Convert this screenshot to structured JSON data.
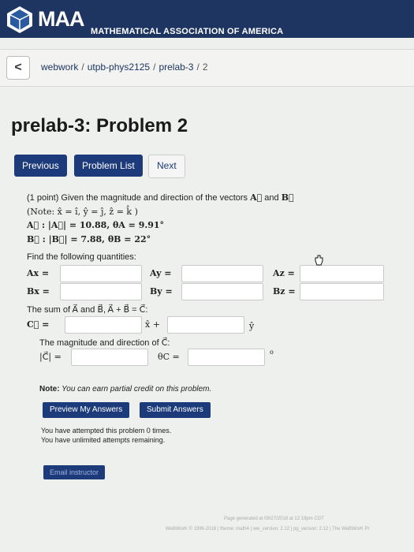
{
  "header": {
    "logo_text": "MAA",
    "org_name": "MATHEMATICAL ASSOCIATION OF AMERICA"
  },
  "breadcrumb": {
    "back": "<",
    "parts": [
      "webwork",
      "utpb-phys2125",
      "prelab-3",
      "2"
    ]
  },
  "page_title": "prelab-3: Problem 2",
  "nav": {
    "previous": "Previous",
    "problem_list": "Problem List",
    "next": "Next"
  },
  "problem": {
    "intro_a": "(1 point) Given the magnitude and direction of the vectors ",
    "vec_a": "A⃗",
    "and": " and ",
    "vec_b": "B⃗",
    "note": "(Note: x̂ = î, ŷ = ĵ, ẑ = k̂ )",
    "line_a": "A⃗ : |A⃗| = 10.88, θA = 9.91°",
    "line_b": "B⃗ : |B⃗| = 7.88, θB = 22°",
    "find": "Find the following quantities:",
    "labels": {
      "ax": "Ax =",
      "ay": "Ay =",
      "az": "Az =",
      "bx": "Bx =",
      "by": "By =",
      "bz": "Bz ="
    },
    "sum_text": "The sum of A⃗ and B⃗, A⃗ + B⃗ = C⃗:",
    "c_label": "C⃗ =",
    "x_plus": "x̂ +",
    "y_hat": "ŷ",
    "mag_text": "The magnitude and direction of C⃗:",
    "c_mag": "|C⃗| =",
    "theta_c": "θC =",
    "degree": "o",
    "note_label": "Note:",
    "note_text": " You can earn partial credit on this problem.",
    "preview": "Preview My Answers",
    "submit": "Submit Answers",
    "attempted": "You have attempted this problem 0 times.",
    "remaining": "You have unlimited attempts remaining.",
    "email": "Email instructor"
  },
  "footer": {
    "generated": "Page generated at 09/27/2018 at 12:19pm CDT",
    "version": "WeBWorK © 1996-2018 | theme: math4 | ww_version: 2.12 | pg_version: 2.12 | The WeBWorK Pr"
  },
  "colors": {
    "header_bg": "#1d3560",
    "button": "#1d3b7a"
  }
}
